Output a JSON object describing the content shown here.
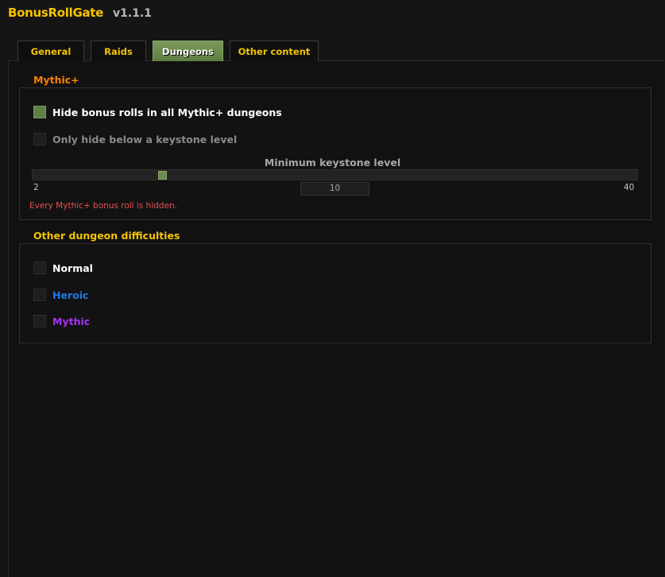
{
  "app": {
    "title": "BonusRollGate",
    "version": "v1.1.1"
  },
  "tabs": [
    {
      "label": "General",
      "active": false
    },
    {
      "label": "Raids",
      "active": false
    },
    {
      "label": "Dungeons",
      "active": true
    },
    {
      "label": "Other content",
      "active": false
    }
  ],
  "mythic_plus": {
    "title": "Mythic+",
    "hide_all": {
      "label": "Hide bonus rolls in all Mythic+ dungeons",
      "checked": true
    },
    "below_keystone": {
      "label": "Only hide below a keystone level",
      "checked": false,
      "disabled": true
    },
    "slider": {
      "title": "Minimum keystone level",
      "min": "2",
      "max": "40",
      "value": "10"
    },
    "warning": "Every Mythic+ bonus roll is hidden."
  },
  "other_difficulties": {
    "title": "Other dungeon difficulties",
    "items": [
      {
        "label": "Normal",
        "checked": false,
        "color": "#ffffff"
      },
      {
        "label": "Heroic",
        "checked": false,
        "color": "#1e78e6"
      },
      {
        "label": "Mythic",
        "checked": false,
        "color": "#a335ee"
      }
    ]
  },
  "colors": {
    "gold": "#f5c400",
    "mythic_plus_orange": "#ff8000",
    "accent_green": "#6d8a52",
    "warning_red": "#e85050"
  }
}
